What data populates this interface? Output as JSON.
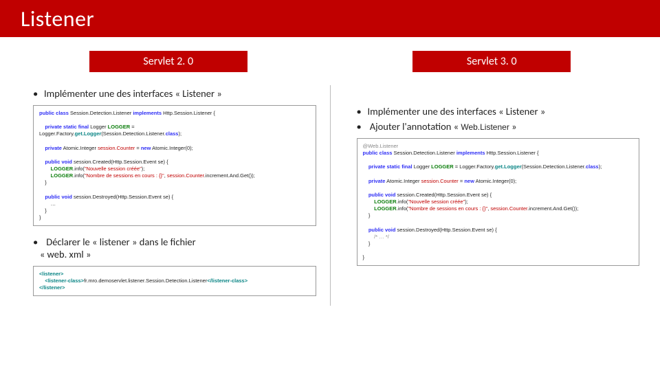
{
  "title": "Listener",
  "left": {
    "tab": "Servlet 2. 0",
    "bullet1": "Implémenter une des interfaces « Listener »",
    "bullet2_a": "Déclarer le « listener » dans le fichier",
    "bullet2_b": "« web. xml »",
    "code1": {
      "l1a": "public class",
      "l1b": "Session.Detection.Listener",
      "l1c": "implements",
      "l1d": "Http.Session.Listener {",
      "l2a": "private static final",
      "l2b": "Logger",
      "l2c": "LOGGER",
      "l2d": " =",
      "l3a": "Logger.Factory.",
      "l3b": "get.Logger",
      "l3c": "(Session.Detection.Listener.",
      "l3d": "class",
      "l3e": ");",
      "l4a": "private",
      "l4b": "Atomic.Integer",
      "l4c": "session.Counter",
      "l4d": " = ",
      "l4e": "new",
      "l4f": "Atomic.Integer(0);",
      "l5a": "public void",
      "l5b": "session.Created(Http.Session.Event se) {",
      "l6a": "LOGGER",
      "l6b": ".info(",
      "l6c": "\"Nouvelle session créée\"",
      "l6d": ");",
      "l7a": "LOGGER",
      "l7b": ".info(",
      "l7c": "\"Nombre de sessions en cours : {}\"",
      "l7d": ", ",
      "l7e": "session.Counter",
      "l7f": ".increment.And.Get());",
      "l8": "}",
      "l9a": "public void",
      "l9b": "session.Destroyed(Http.Session.Event se) {",
      "l10": "…",
      "l11": "}",
      "l12": "}"
    },
    "code2": {
      "l1": "<listener>",
      "l2a": "<listener-class>",
      "l2b": "fr.mro.demoservlet.listener.Session.Detection.Listener",
      "l2c": "</listener-class>",
      "l3": "</listener>"
    }
  },
  "right": {
    "tab": "Servlet 3. 0",
    "bullet1": "Implémenter une des interfaces « Listener »",
    "bullet2": "Ajouter l'annotation « ",
    "bullet2_code": "Web.Listener",
    "bullet2_end": " »",
    "code": {
      "l0": "@Web.Listener",
      "l1a": "public class",
      "l1b": "Session.Detection.Listener",
      "l1c": "implements",
      "l1d": "Http.Session.Listener {",
      "l2a": "private static final",
      "l2b": "Logger",
      "l2c": "LOGGER",
      "l2d": " = Logger.Factory.",
      "l2e": "get.Logger",
      "l2f": "(Session.Detection.Listener.",
      "l2g": "class",
      "l2h": ");",
      "l4a": "private",
      "l4b": "Atomic.Integer",
      "l4c": "session.Counter",
      "l4d": " = ",
      "l4e": "new",
      "l4f": "Atomic.Integer(0);",
      "l5a": "public void",
      "l5b": "session.Created(Http.Session.Event se) {",
      "l6a": "LOGGER",
      "l6b": ".info(",
      "l6c": "\"Nouvelle session créée\"",
      "l6d": ");",
      "l7a": "LOGGER",
      "l7b": ".info(",
      "l7c": "\"Nombre de sessions en cours : {}\"",
      "l7d": ", ",
      "l7e": "session.Counter",
      "l7f": ".increment.And.Get());",
      "l8": "}",
      "l9a": "public void",
      "l9b": "session.Destroyed(Http.Session.Event se) {",
      "l10": "/* … */",
      "l11": "}",
      "l12": "}"
    }
  }
}
